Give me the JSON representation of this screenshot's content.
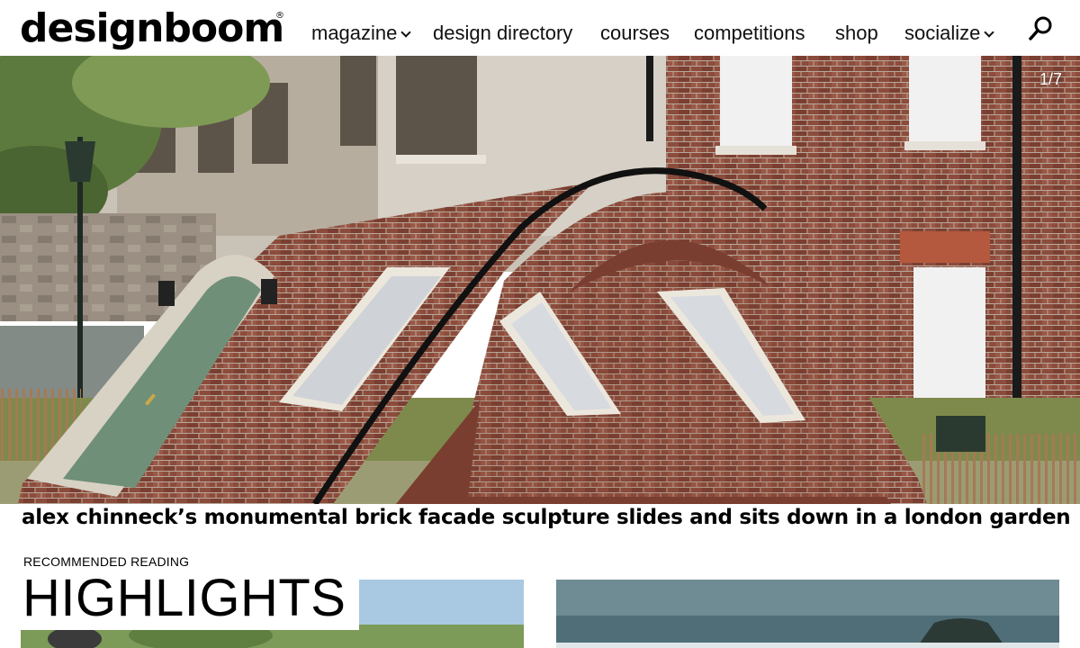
{
  "brand": {
    "logo_text": "designboom",
    "reg_mark": "®"
  },
  "nav": {
    "items": [
      {
        "label": "magazine",
        "has_dropdown": true
      },
      {
        "label": "design directory",
        "has_dropdown": false
      },
      {
        "label": "courses",
        "has_dropdown": false
      },
      {
        "label": "competitions",
        "has_dropdown": false
      },
      {
        "label": "shop",
        "has_dropdown": false
      },
      {
        "label": "socialize",
        "has_dropdown": true
      }
    ],
    "search_icon": "search-icon"
  },
  "hero": {
    "slide_counter": "1/7",
    "article_title": "alex chinneck’s monumental brick facade sculpture slides and sits down in a london garden"
  },
  "recommended": {
    "label": "RECOMMENDED READING",
    "heading": "HIGHLIGHTS"
  },
  "colors": {
    "brick": "#8a4a3a",
    "door_green": "#6f8f78",
    "sky_left": "#9cc0dc",
    "sea_right": "#4f6e78"
  }
}
